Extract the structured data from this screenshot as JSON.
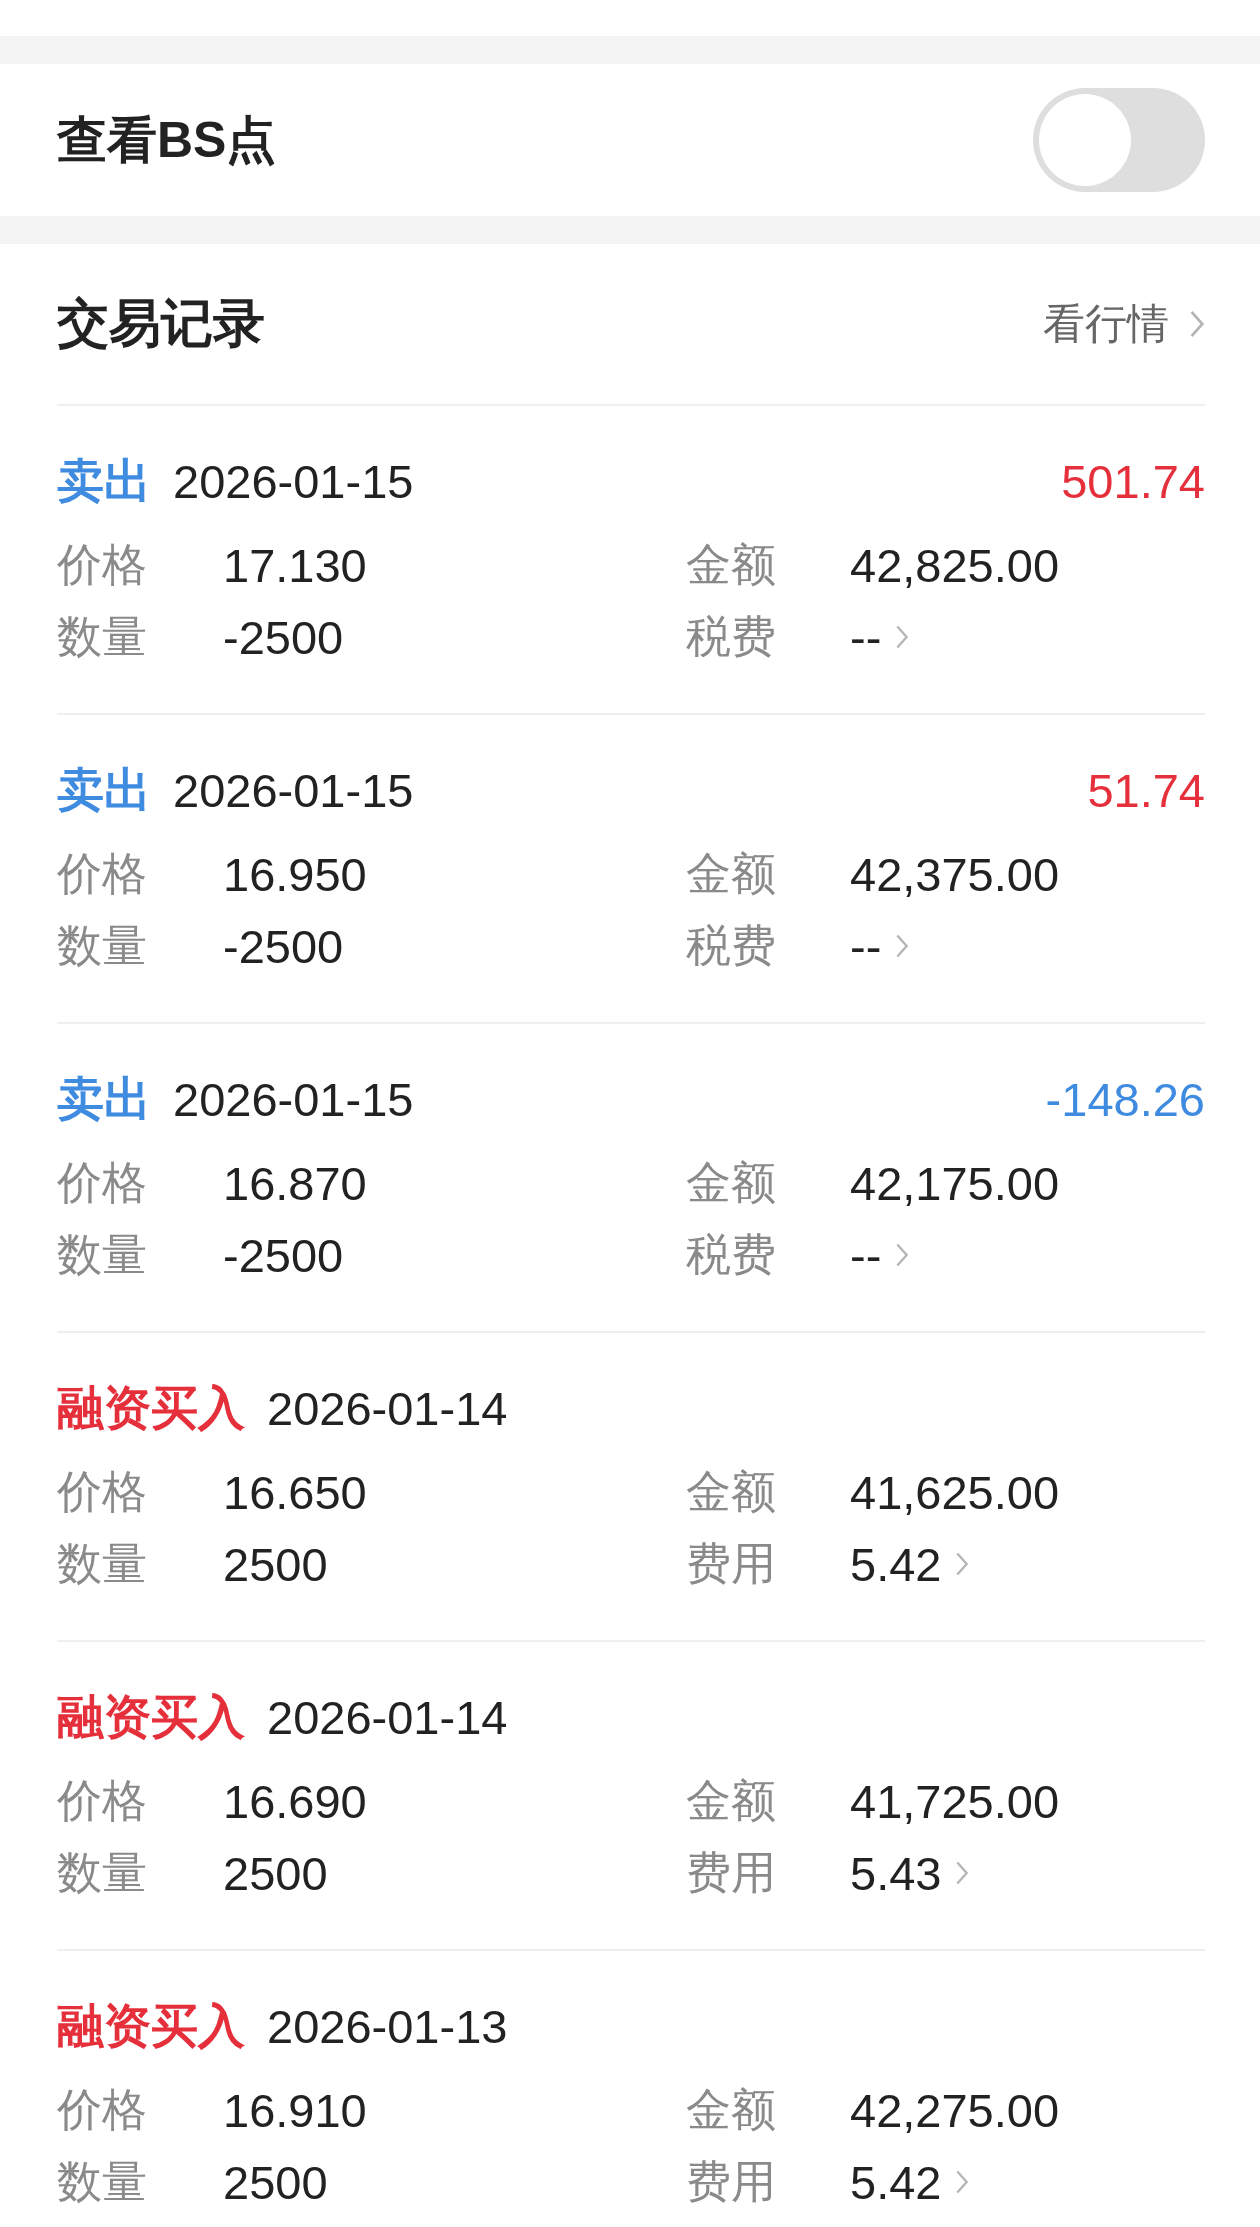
{
  "bs_toggle": {
    "label": "查看BS点",
    "on": false
  },
  "trades_section": {
    "title": "交易记录",
    "link": "看行情",
    "records": [
      {
        "kind": "sell",
        "type": "卖出",
        "date": "2026-01-15",
        "profit": {
          "value": "501.74",
          "color": "#e5303c"
        },
        "price_label": "价格",
        "price": "17.130",
        "amount_label": "金额",
        "amount": "42,825.00",
        "quantity_label": "数量",
        "quantity": "-2500",
        "fee_label": "税费",
        "fee": "--"
      },
      {
        "kind": "sell",
        "type": "卖出",
        "date": "2026-01-15",
        "profit": {
          "value": "51.74",
          "color": "#e5303c"
        },
        "price_label": "价格",
        "price": "16.950",
        "amount_label": "金额",
        "amount": "42,375.00",
        "quantity_label": "数量",
        "quantity": "-2500",
        "fee_label": "税费",
        "fee": "--"
      },
      {
        "kind": "sell",
        "type": "卖出",
        "date": "2026-01-15",
        "profit": {
          "value": "-148.26",
          "color": "#3f8be0"
        },
        "price_label": "价格",
        "price": "16.870",
        "amount_label": "金额",
        "amount": "42,175.00",
        "quantity_label": "数量",
        "quantity": "-2500",
        "fee_label": "税费",
        "fee": "--"
      },
      {
        "kind": "margin_buy",
        "type": "融资买入",
        "date": "2026-01-14",
        "price_label": "价格",
        "price": "16.650",
        "amount_label": "金额",
        "amount": "41,625.00",
        "quantity_label": "数量",
        "quantity": "2500",
        "fee_label": "费用",
        "fee": "5.42"
      },
      {
        "kind": "margin_buy",
        "type": "融资买入",
        "date": "2026-01-14",
        "price_label": "价格",
        "price": "16.690",
        "amount_label": "金额",
        "amount": "41,725.00",
        "quantity_label": "数量",
        "quantity": "2500",
        "fee_label": "费用",
        "fee": "5.43"
      },
      {
        "kind": "margin_buy",
        "type": "融资买入",
        "date": "2026-01-13",
        "price_label": "价格",
        "price": "16.910",
        "amount_label": "金额",
        "amount": "42,275.00",
        "quantity_label": "数量",
        "quantity": "2500",
        "fee_label": "费用",
        "fee": "5.42"
      }
    ]
  }
}
